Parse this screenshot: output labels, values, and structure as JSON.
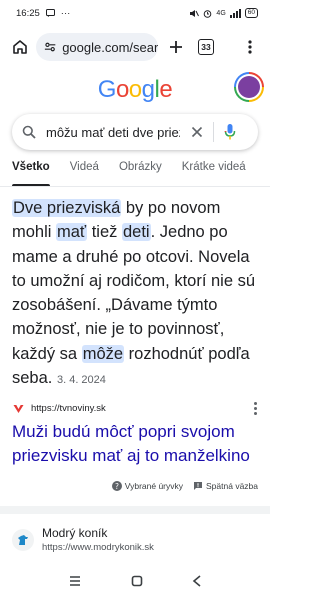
{
  "status_bar": {
    "time": "16:25",
    "more": "···",
    "network": "4G",
    "battery": "60"
  },
  "browser": {
    "url": "google.com/search",
    "tab_count": "33"
  },
  "google": {
    "logo": [
      "G",
      "o",
      "o",
      "g",
      "l",
      "e"
    ],
    "logo_colors": [
      "#4285f4",
      "#ea4335",
      "#fbbc05",
      "#4285f4",
      "#34a853",
      "#ea4335"
    ]
  },
  "search": {
    "query": "môžu mať deti dve priezviská"
  },
  "tabs": [
    "Všetko",
    "Videá",
    "Obrázky",
    "Krátke videá"
  ],
  "snippet": {
    "p1": "Dve priezviská",
    "p2": " by po novom mohli ",
    "p3": "mať",
    "p4": " tiež ",
    "p5": "deti",
    "p6": ". Jedno po mame a druhé po otcovi. Novela to umožní aj rodičom, ktorí nie sú zosobášení. „Dávame týmto možnosť, nie je to povinnosť, každý sa ",
    "p7": "môže",
    "p8": " rozhodnúť podľa seba.",
    "date": "3. 4. 2024"
  },
  "result": {
    "source_url": "https://tvnoviny.sk",
    "title": "Muži budú môcť popri svojom priezvisku mať aj to manželkino"
  },
  "feedback": {
    "featured": "Vybrané úryvky",
    "feedback": "Spätná väzba"
  },
  "result2": {
    "name": "Modrý koník",
    "url": "https://www.modrykonik.sk"
  },
  "colors": {
    "accent": "#1a73e8",
    "link": "#1a0dab",
    "highlight": "#d3e3fd",
    "tvnoviny": "#e53935"
  }
}
